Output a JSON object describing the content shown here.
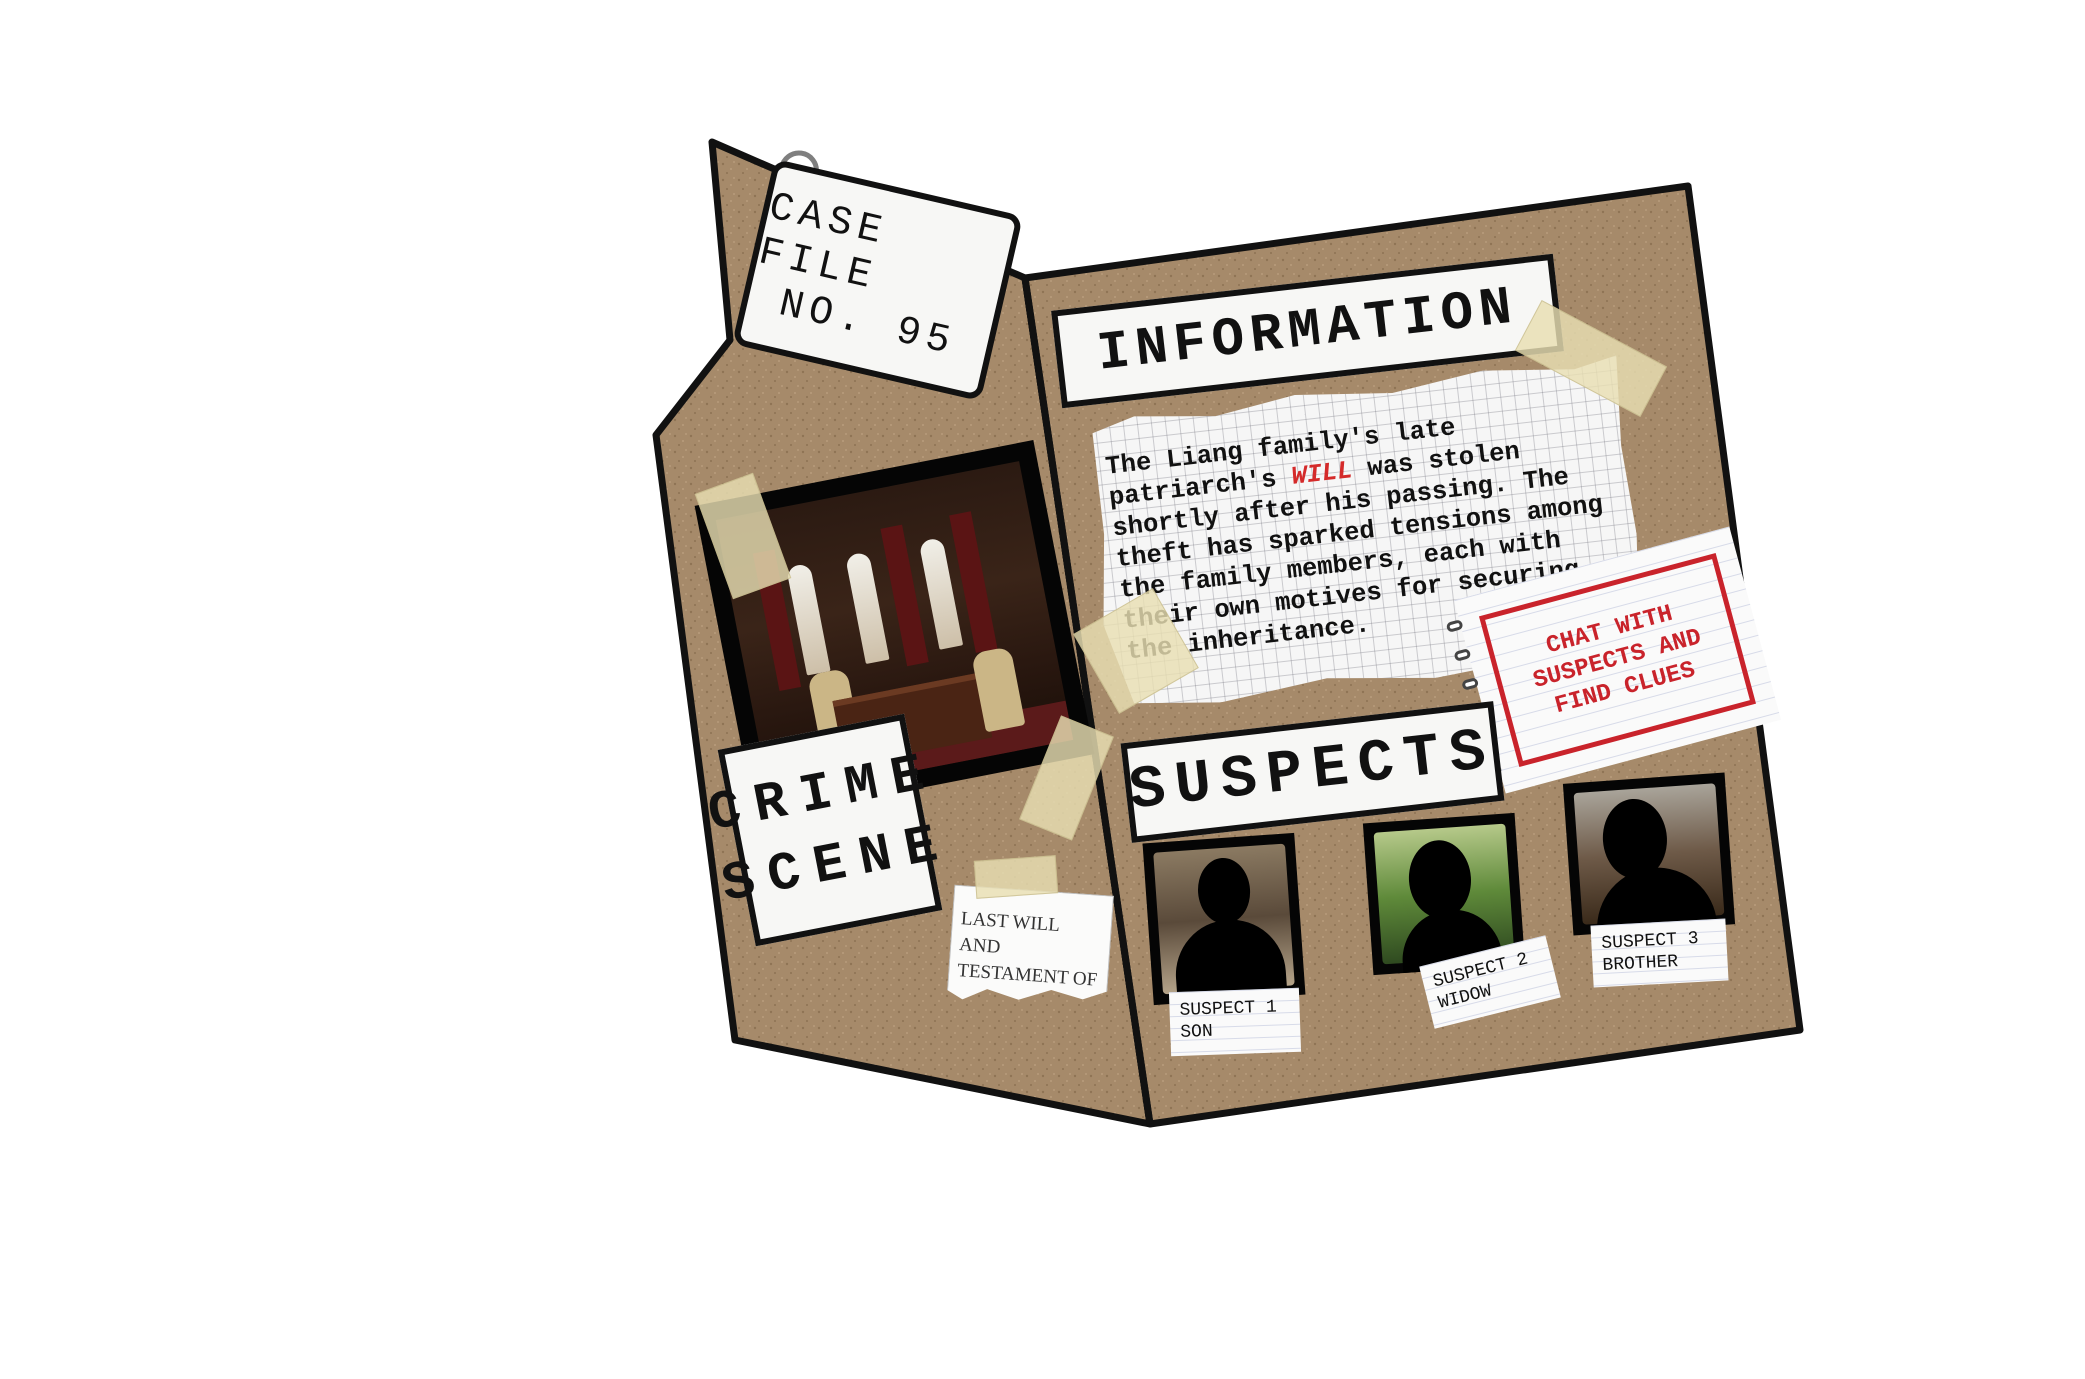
{
  "case_file": {
    "line1": "CASE FILE",
    "line2": "NO. 95"
  },
  "crime_scene": {
    "line1": "CRIME",
    "line2": "SCENE"
  },
  "will_document": {
    "line1": "LAST WILL AND",
    "line2": "TESTAMENT OF"
  },
  "information": {
    "title": "INFORMATION",
    "text_before": "The Liang family's late patriarch's ",
    "highlight": "WILL",
    "text_after": " was stolen shortly after his passing. The theft has sparked tensions among the family members, each with their own motives for securing the inheritance."
  },
  "chat_note": {
    "line1": "CHAT WITH",
    "line2": "SUSPECTS AND",
    "line3": "FIND CLUES"
  },
  "suspects": {
    "title": "SUSPECTS",
    "items": [
      {
        "label": "SUSPECT 1",
        "role": "SON"
      },
      {
        "label": "SUSPECT 2",
        "role": "WIDOW"
      },
      {
        "label": "SUSPECT 3",
        "role": "BROTHER"
      }
    ]
  },
  "colors": {
    "folder": "#a68a6a",
    "outline": "#111111",
    "accent_red": "#c9232b"
  }
}
